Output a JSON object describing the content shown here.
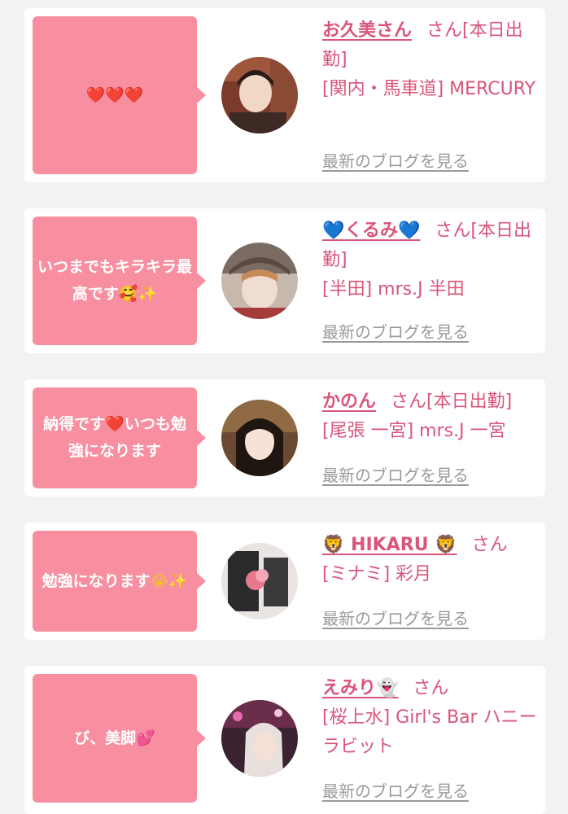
{
  "items": [
    {
      "comment_text": "",
      "comment_emoji": "❤️❤️❤️",
      "name": "お久美さん",
      "honorific": "さん",
      "status": "[本日出勤]",
      "location": "[関内・馬車道] MERCURY",
      "blog_link": "最新のブログを見る"
    },
    {
      "comment_text": "いつまでもキラキラ最高です",
      "comment_emoji": "🥰✨",
      "name_prefix": "💙",
      "name": "くるみ",
      "name_suffix": "💙",
      "honorific": "さん",
      "status": "[本日出勤]",
      "location": "[半田] mrs.J 半田",
      "blog_link": "最新のブログを見る"
    },
    {
      "comment_text_a": "納得です",
      "comment_emoji": "❤️",
      "comment_text_b": "いつも勉強になります",
      "name": "かのん",
      "honorific": "さん",
      "status": "[本日出勤]",
      "location": "[尾張 一宮] mrs.J 一宮",
      "blog_link": "最新のブログを見る"
    },
    {
      "comment_text": "勉強になります",
      "comment_emoji": "😭✨",
      "name_prefix": "🦁",
      "name": "HIKARU",
      "name_suffix": "🦁",
      "honorific": "さん",
      "location": "[ミナミ] 彩月",
      "blog_link": "最新のブログを見る"
    },
    {
      "comment_text": "び、美脚",
      "comment_emoji": "💕",
      "name": "えみり",
      "name_suffix": "👻",
      "honorific": "さん",
      "location": "[桜上水] Girl's Bar ハニーラビット",
      "blog_link": "最新のブログを見る"
    }
  ],
  "colors": {
    "bubble": "#f78fa0",
    "name": "#d9557a",
    "link_gray": "#9a9a9a",
    "page_bg": "#f3f1f2"
  }
}
